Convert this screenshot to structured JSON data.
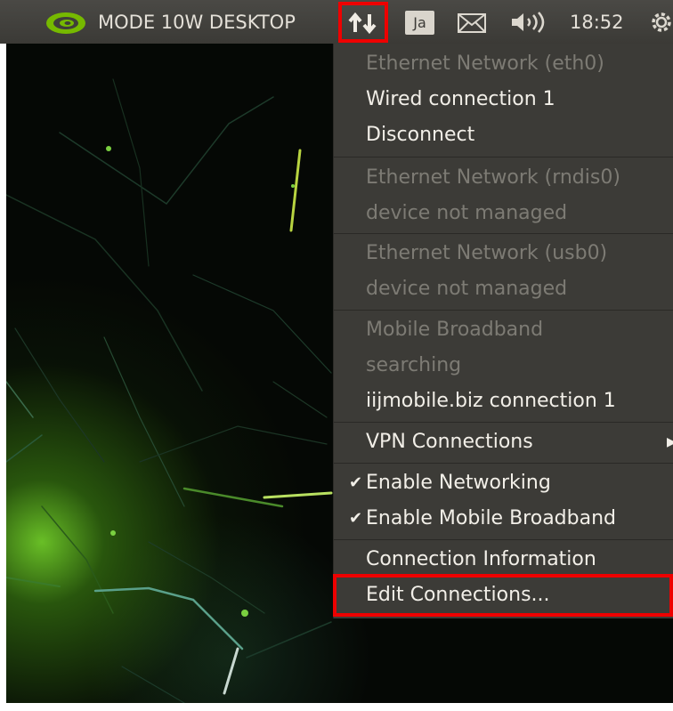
{
  "panel": {
    "mode_label": "MODE 10W DESKTOP",
    "input_method": "Ja",
    "clock": "18:52",
    "icons": [
      "nvidia-logo",
      "network-icon",
      "mail-icon",
      "volume-icon",
      "gear-icon"
    ]
  },
  "network_menu": {
    "items": [
      {
        "label": "Ethernet Network (eth0)",
        "enabled": false
      },
      {
        "label": "Wired connection 1",
        "enabled": true
      },
      {
        "label": "Disconnect",
        "enabled": true
      },
      {
        "label": "Ethernet Network (rndis0)",
        "enabled": false
      },
      {
        "label": "device not managed",
        "enabled": false
      },
      {
        "label": "Ethernet Network (usb0)",
        "enabled": false
      },
      {
        "label": "device not managed",
        "enabled": false
      },
      {
        "label": "Mobile Broadband",
        "enabled": false
      },
      {
        "label": "searching",
        "enabled": false
      },
      {
        "label": "iijmobile.biz connection 1",
        "enabled": true
      },
      {
        "label": "VPN Connections",
        "enabled": true,
        "submenu": true
      },
      {
        "label": "Enable Networking",
        "enabled": true,
        "checked": true
      },
      {
        "label": "Enable Mobile Broadband",
        "enabled": true,
        "checked": true
      },
      {
        "label": "Connection Information",
        "enabled": true
      },
      {
        "label": "Edit Connections...",
        "enabled": true
      }
    ]
  },
  "colors": {
    "panel_bg": "#3c3b37",
    "menu_bg": "#3c3b37",
    "menu_text": "#f2efe8",
    "menu_text_disabled": "#7d7b74",
    "highlight_box": "#ee0000",
    "nvidia_green": "#76b900"
  }
}
